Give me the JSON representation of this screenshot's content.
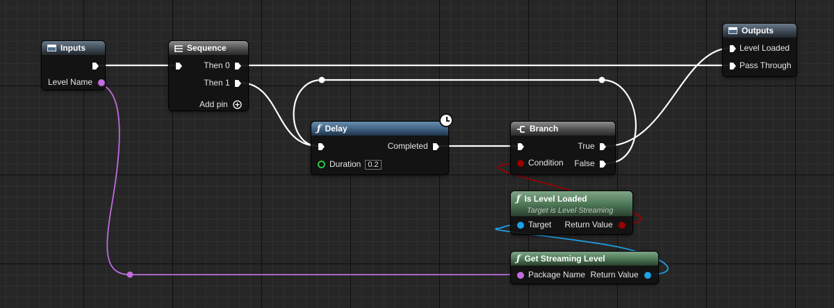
{
  "colors": {
    "exec_wire": "#ffffff",
    "string_wire": "#c16cdf",
    "object_wire": "#1ea0e6",
    "bool_wire": "#990000"
  },
  "nodes": {
    "inputs": {
      "title": "Inputs",
      "icon": "window-icon",
      "level_name": "Level Name"
    },
    "sequence": {
      "title": "Sequence",
      "icon": "sequence-icon",
      "then0": "Then 0",
      "then1": "Then 1",
      "add_pin": "Add pin"
    },
    "delay": {
      "title": "Delay",
      "icon": "function-icon",
      "completed": "Completed",
      "duration": "Duration",
      "duration_value": "0.2"
    },
    "branch": {
      "title": "Branch",
      "icon": "branch-icon",
      "true_label": "True",
      "false_label": "False",
      "condition": "Condition"
    },
    "outputs": {
      "title": "Outputs",
      "icon": "window-icon",
      "level_loaded": "Level Loaded",
      "pass_through": "Pass Through"
    },
    "is_level_loaded": {
      "title": "Is Level Loaded",
      "subtitle": "Target is Level Streaming",
      "target": "Target",
      "return_value": "Return Value"
    },
    "get_streaming_level": {
      "title": "Get Streaming Level",
      "package_name": "Package Name",
      "return_value": "Return Value"
    }
  }
}
